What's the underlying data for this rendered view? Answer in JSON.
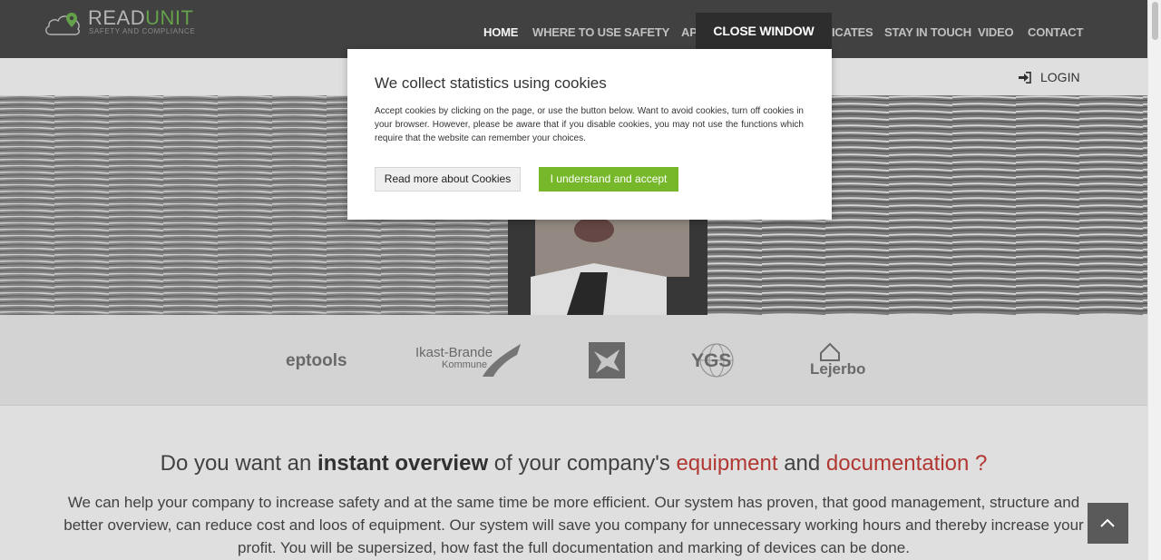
{
  "brand": {
    "name_part1": "READ",
    "name_part2": "UNIT",
    "tagline": "SAFETY AND COMPLIANCE",
    "accent_color": "#6aa84f"
  },
  "nav": {
    "items": [
      {
        "label": "HOME",
        "active": true
      },
      {
        "label": "WHERE TO USE"
      },
      {
        "label": "SAFETY"
      },
      {
        "label": "AP"
      },
      {
        "label": "ICATES"
      },
      {
        "label": "STAY IN TOUCH"
      },
      {
        "label": "VIDEO"
      },
      {
        "label": "CONTACT"
      }
    ]
  },
  "login": {
    "label": "LOGIN",
    "icon": "sign-in-icon"
  },
  "partners": [
    {
      "label": "eptools"
    },
    {
      "label": "Ikast-Brande",
      "sub": "Kommune"
    },
    {
      "label": "eagle-logo"
    },
    {
      "label": "YGS"
    },
    {
      "label": "Lejerbo"
    }
  ],
  "content": {
    "headline": {
      "part1": "Do you want an ",
      "bold": "instant overview",
      "part2": " of your company's ",
      "red1": "equipment",
      "part3": " and ",
      "red2": "documentation ?"
    },
    "paragraph": "We can help your company to increase safety and at the same time be more efficient. Our system has proven, that good management, structure and better overview, can reduce cost and loos of equipment. Our system will save you company for unnecessary working hours and thereby increase your profit. You will be supersized, how fast the full documentation and marking of devices can be done."
  },
  "cookie": {
    "close_label": "CLOSE WINDOW",
    "title": "We collect statistics using cookies",
    "text": "Accept cookies by clicking on the page, or use the button below. Want to avoid cookies, turn off cookies in your browser. However, please be aware that if you disable cookies, you may not use the functions which require that the website can remember your choices.",
    "read_more": "Read more about Cookies",
    "accept": "I understand and accept",
    "accept_color": "#76b82a"
  },
  "colors": {
    "header_bg": "#444444",
    "headline_red": "#b93a35"
  }
}
